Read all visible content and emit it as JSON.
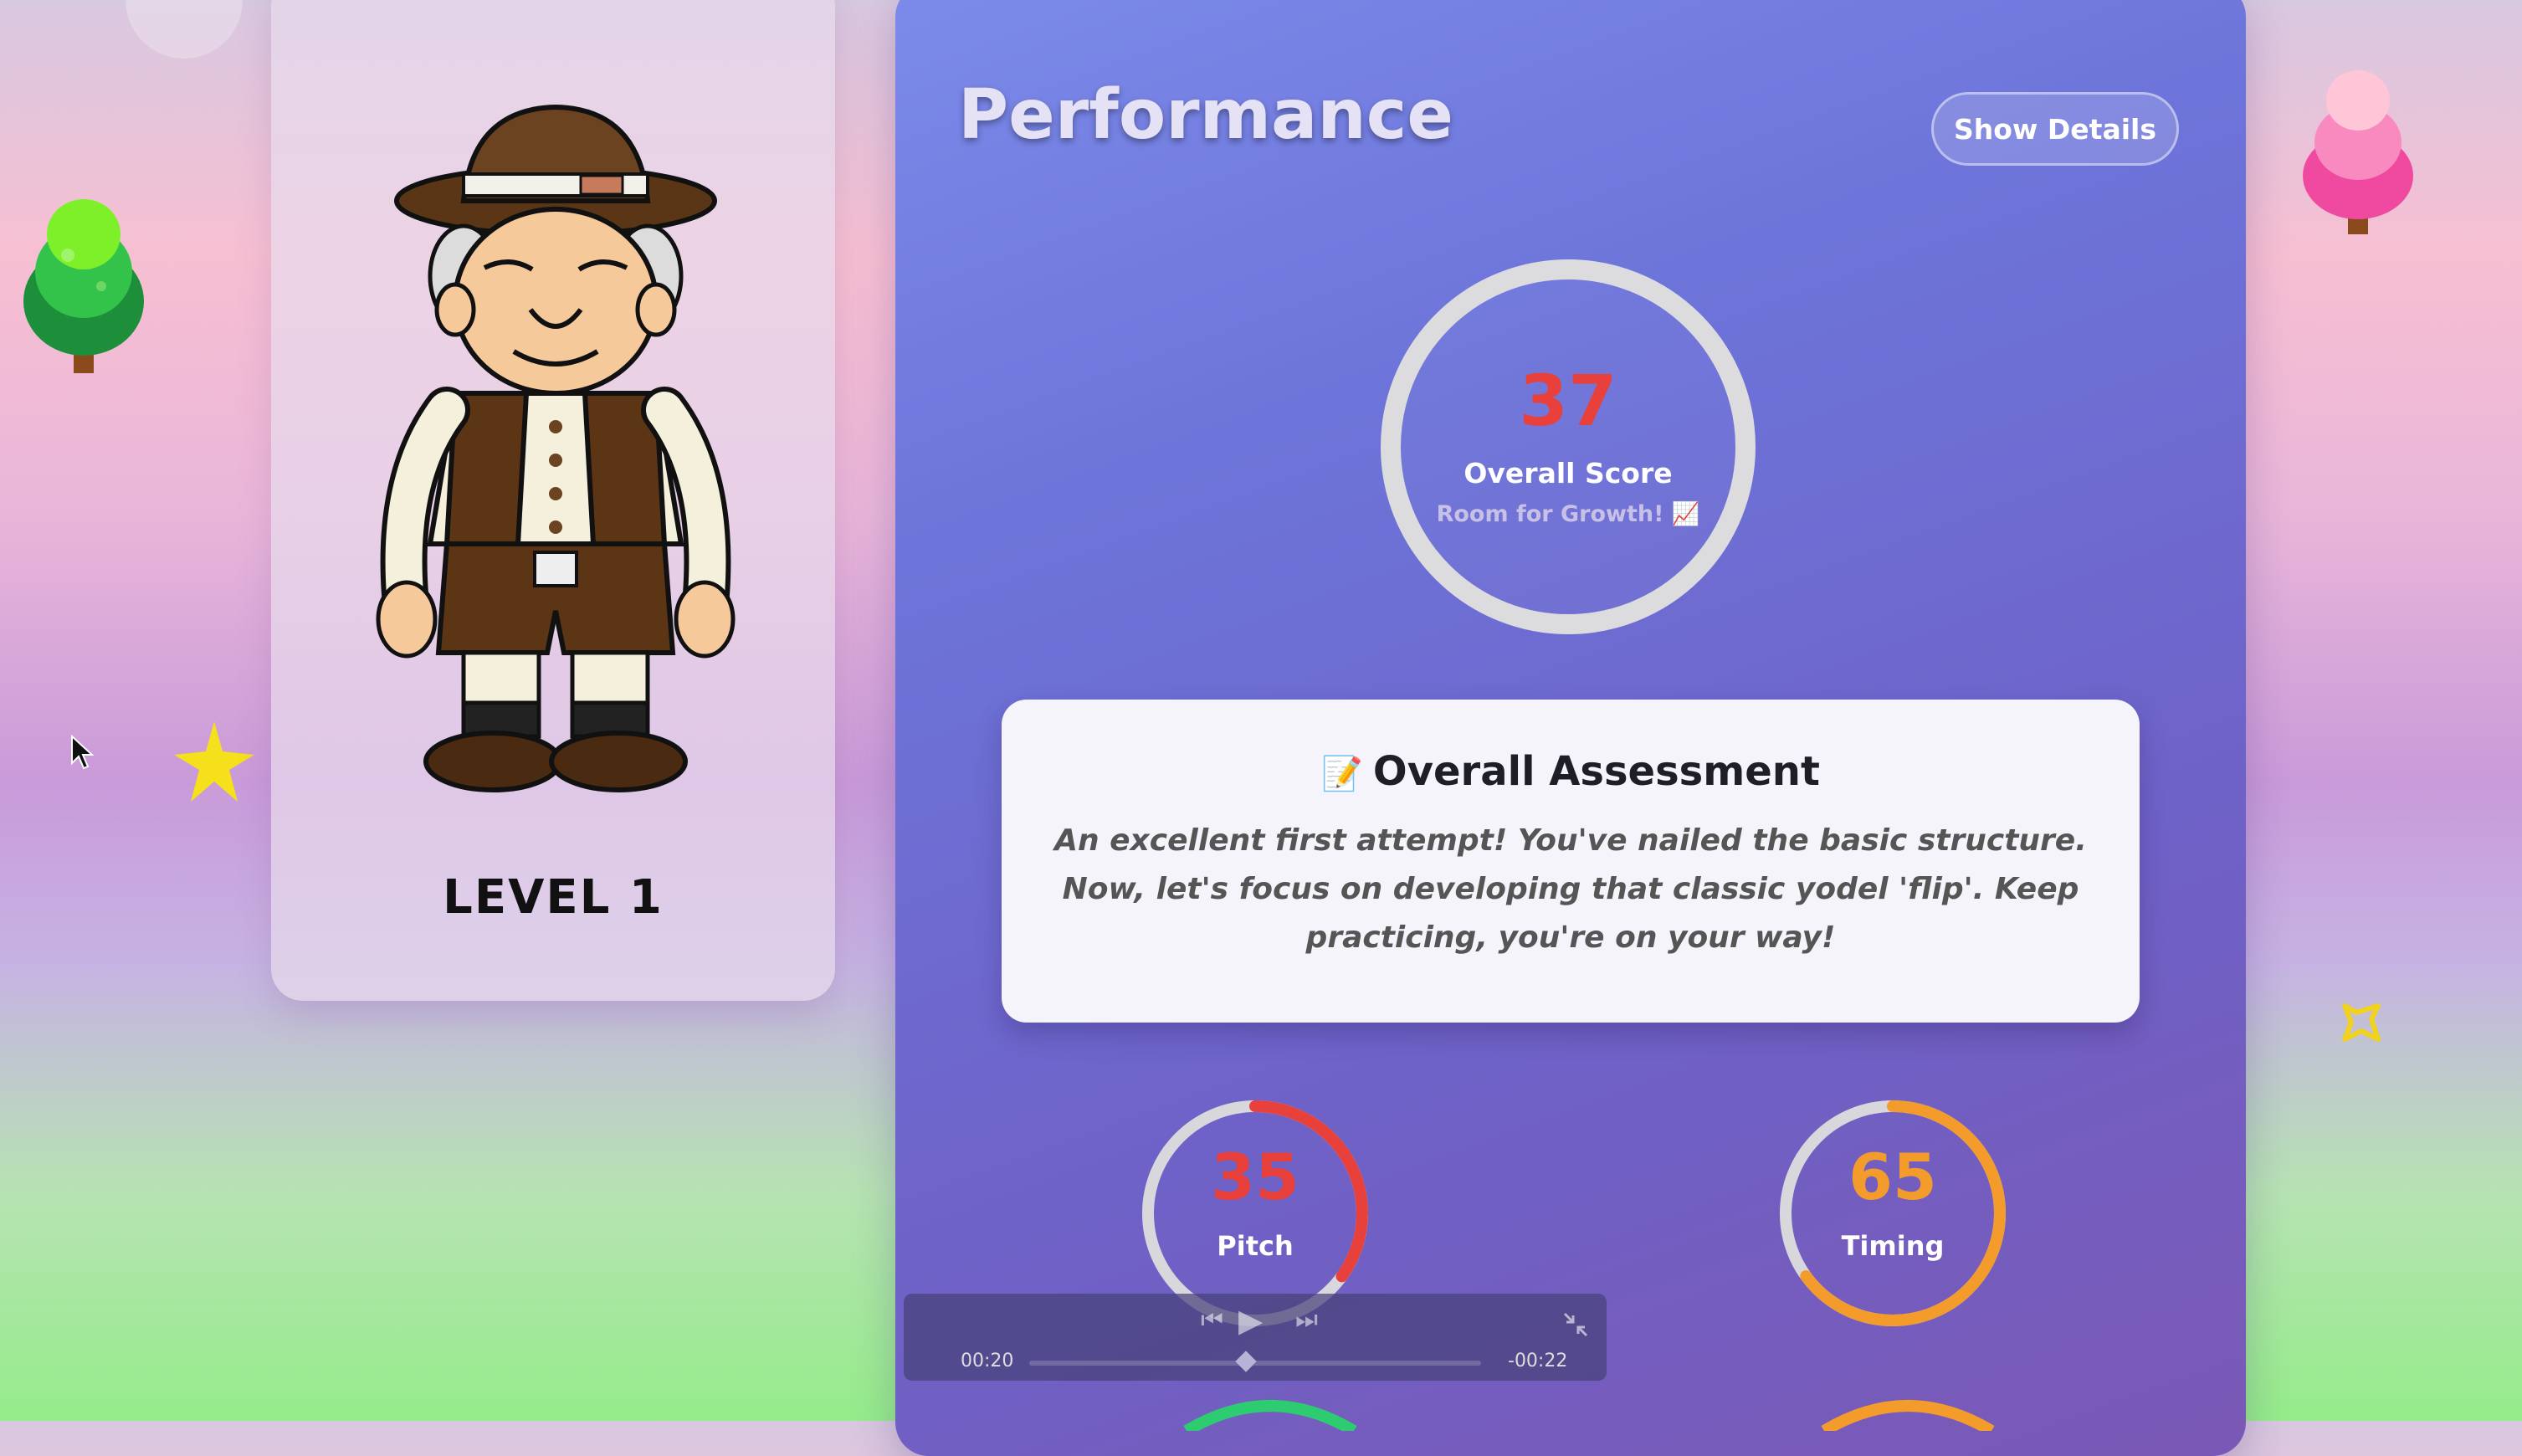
{
  "character_card": {
    "level_label": "LEVEL 1"
  },
  "performance": {
    "title": "Performance",
    "details_button": "Show Details",
    "overall": {
      "score": "37",
      "score_value": 37,
      "label": "Overall Score",
      "subtitle": "Room for Growth! 📈",
      "score_color": "#e8413c"
    },
    "assessment": {
      "icon": "📝",
      "title": "Overall Assessment",
      "text": "An excellent first attempt! You've nailed the basic structure. Now, let's focus on developing that classic yodel 'flip'. Keep practicing, you're on your way!"
    },
    "metrics": [
      {
        "score": "35",
        "value": 35,
        "label": "Pitch",
        "color": "#e8413c"
      },
      {
        "score": "65",
        "value": 65,
        "label": "Timing",
        "color": "#f39c2b"
      }
    ]
  },
  "media_player": {
    "elapsed": "00:20",
    "remaining": "-00:22",
    "progress_fraction": 0.48
  },
  "colors": {
    "accent_green": "#2ecc71",
    "accent_orange": "#f39c2b",
    "accent_red": "#e8413c"
  }
}
